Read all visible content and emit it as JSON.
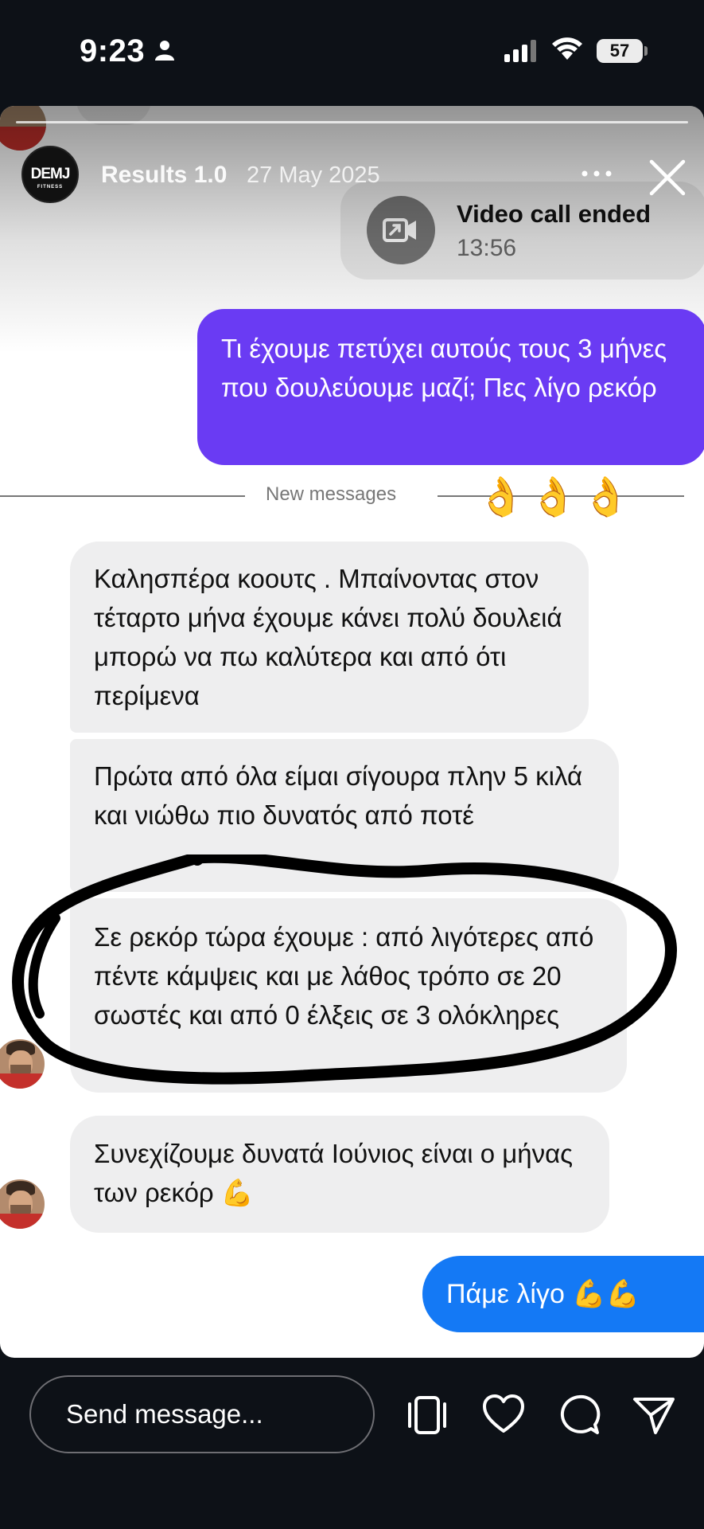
{
  "status_bar": {
    "time": "9:23",
    "battery": "57"
  },
  "story": {
    "title": "Results 1.0",
    "date": "27 May 2025",
    "brand_logo": "DEMJ",
    "brand_sub": "FITNESS"
  },
  "call": {
    "title": "Video call ended",
    "time": "13:56"
  },
  "messages": {
    "sent_question": "Τι έχουμε πετύχει αυτούς τους 3 μήνες που δουλεύουμε μαζί; Πες λίγο ρεκόρ",
    "divider": "New messages",
    "reactions": "👌👌👌",
    "received": [
      "Καλησπέρα κοουτς . Μπαίνοντας στον τέταρτο μήνα έχουμε κάνει πολύ δουλειά μπορώ να πω καλύτερα και από ότι περίμενα",
      "Πρώτα από όλα είμαι σίγουρα πλην 5 κιλά και νιώθω πιο δυνατός από ποτέ",
      "Σε ρεκόρ τώρα έχουμε : από λιγότερες από πέντε κάμψεις και με λάθος τρόπο σε 20 σωστές και από 0 έλξεις σε 3 ολόκληρες",
      "Συνεχίζουμε δυνατά Ιούνιος είναι ο μήνας των ρεκόρ 💪"
    ],
    "sent_reply": "Πάμε λίγο 💪💪"
  },
  "composer": {
    "placeholder": "Send message..."
  },
  "colors": {
    "purple_bubble": "#6a3bf3",
    "blue_bubble": "#1479f5",
    "received_bubble": "#eeeeef",
    "background": "#0d1117"
  },
  "icons": [
    "person-icon",
    "signal-icon",
    "wifi-icon",
    "battery-icon",
    "more-icon",
    "close-icon",
    "video-call-icon",
    "carousel-icon",
    "heart-icon",
    "comment-icon",
    "send-icon"
  ]
}
